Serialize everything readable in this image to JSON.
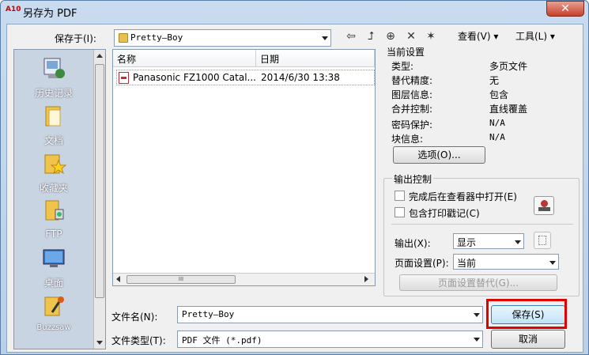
{
  "window": {
    "title": "另存为 PDF",
    "app_badge": "A10",
    "close_symbol": "✕"
  },
  "toolbar": {
    "save_in_label": "保存于(I):",
    "save_in_value": "Pretty—Boy",
    "view_menu": "查看(V)",
    "tools_menu": "工具(L)"
  },
  "places": [
    {
      "label": "历史记录",
      "icon": "history-icon"
    },
    {
      "label": "文档",
      "icon": "documents-icon"
    },
    {
      "label": "收藏夹",
      "icon": "favorites-icon"
    },
    {
      "label": "FTP",
      "icon": "ftp-icon"
    },
    {
      "label": "桌面",
      "icon": "desktop-icon"
    },
    {
      "label": "Buzzsaw",
      "icon": "buzzsaw-icon"
    }
  ],
  "file_list": {
    "columns": [
      "名称",
      "日期"
    ],
    "rows": [
      {
        "name": "Panasonic FZ1000 Catal...",
        "date": "2014/6/30 13:38"
      }
    ],
    "hscroll_grip": "III"
  },
  "current_settings": {
    "title": "当前设置",
    "rows": [
      {
        "key": "类型:",
        "value": "多页文件"
      },
      {
        "key": "替代精度:",
        "value": "无"
      },
      {
        "key": "图层信息:",
        "value": "包含"
      },
      {
        "key": "合并控制:",
        "value": "直线覆盖"
      },
      {
        "key": "密码保护:",
        "value": "N/A"
      },
      {
        "key": "块信息:",
        "value": "N/A"
      }
    ],
    "options_button": "选项(O)..."
  },
  "output_control": {
    "title": "输出控制",
    "open_in_viewer": "完成后在查看器中打开(E)",
    "include_stamp": "包含打印戳记(C)",
    "output_label": "输出(X):",
    "output_value": "显示",
    "page_setup_label": "页面设置(P):",
    "page_setup_value": "当前",
    "page_setup_override": "页面设置替代(G)..."
  },
  "bottom": {
    "filename_label": "文件名(N):",
    "filename_value": "Pretty—Boy",
    "filetype_label": "文件类型(T):",
    "filetype_value": "PDF 文件 (*.pdf)",
    "save_button": "保存(S)",
    "cancel_button": "取消"
  },
  "colors": {
    "highlight": "#e00000",
    "title_bar": "#c9dbef"
  }
}
